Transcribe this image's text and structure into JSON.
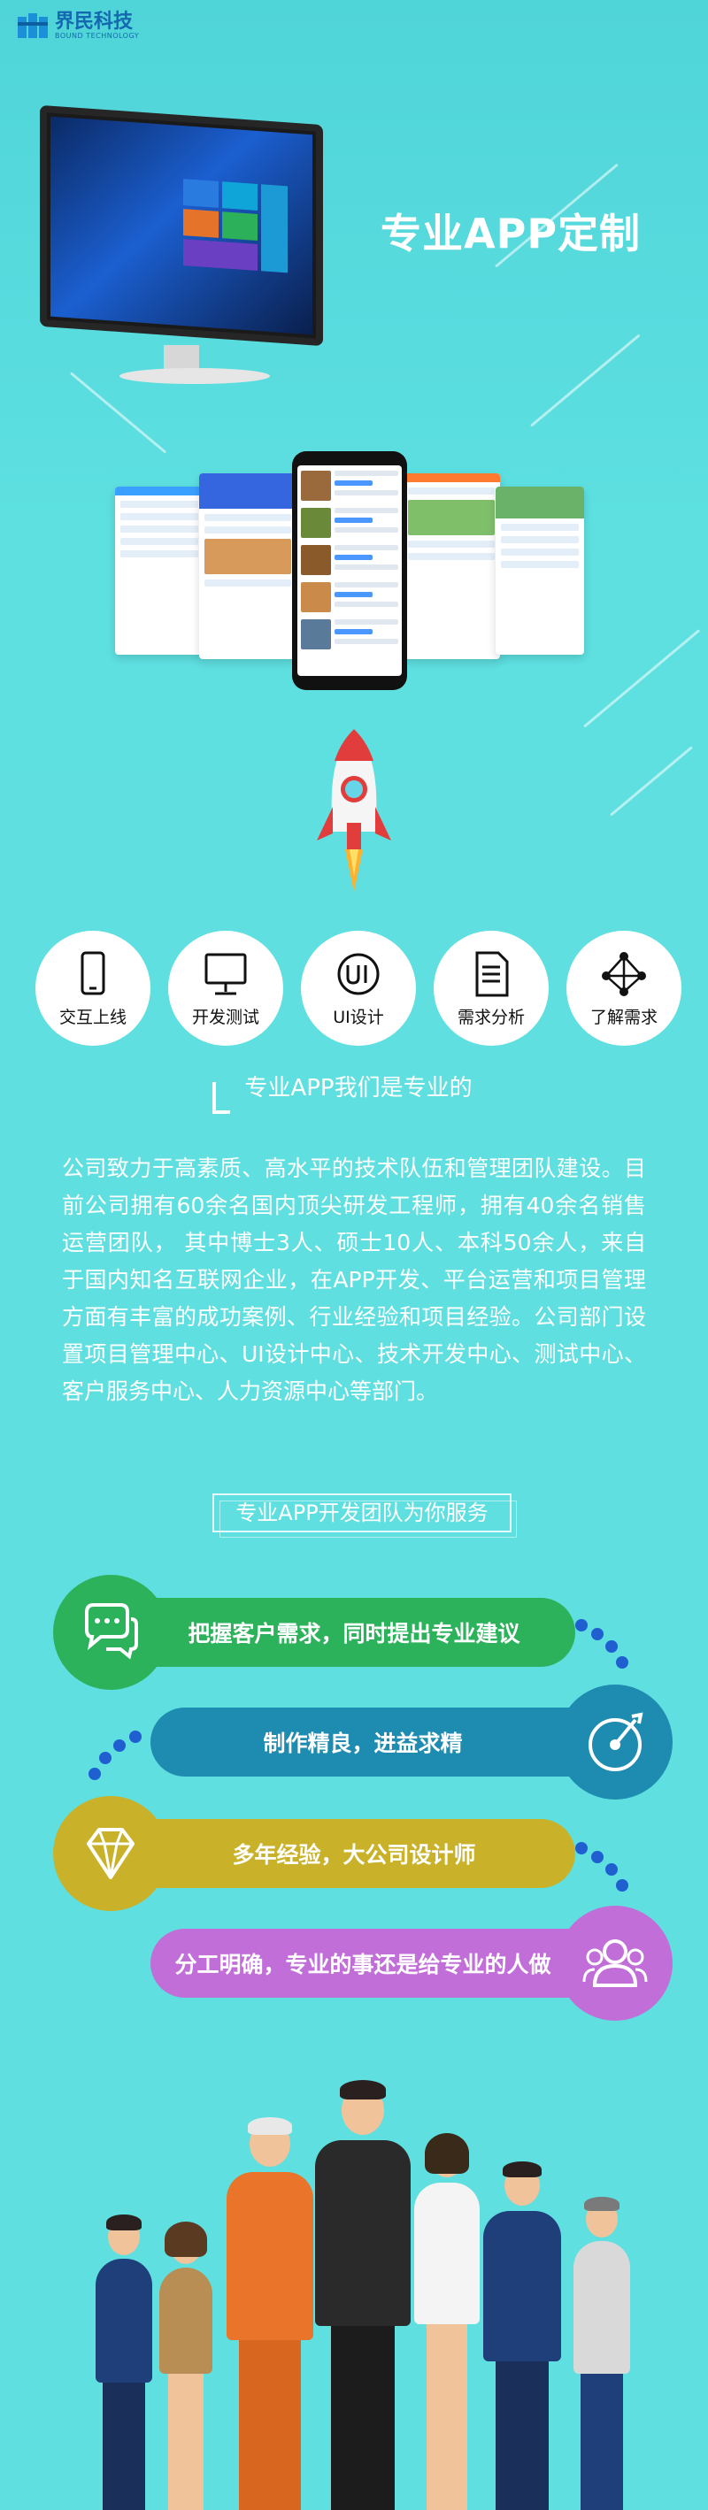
{
  "brand": {
    "name_cn": "界民科技",
    "name_en": "BOUND TECHNOLOGY",
    "color": "#1468b0"
  },
  "hero": {
    "headline": "专业APP定制"
  },
  "steps": [
    {
      "label": "交互上线",
      "icon": "phone-icon"
    },
    {
      "label": "开发测试",
      "icon": "monitor-icon"
    },
    {
      "label": "UI设计",
      "icon": "ui-icon"
    },
    {
      "label": "需求分析",
      "icon": "document-icon"
    },
    {
      "label": "了解需求",
      "icon": "network-icon"
    }
  ],
  "section1": {
    "title": "专业APP我们是专业的"
  },
  "intro": {
    "text": "公司致力于高素质、高水平的技术队伍和管理团队建设。目前公司拥有60余名国内顶尖研发工程师，拥有40余名销售运营团队， 其中博士3人、硕士10人、本科50余人，来自于国内知名互联网企业，在APP开发、平台运营和项目管理方面有丰富的成功案例、行业经验和项目经验。公司部门设置项目管理中心、UI设计中心、技术开发中心、测试中心、客户服务中心、人力资源中心等部门。"
  },
  "section2": {
    "title": "专业APP开发团队为你服务"
  },
  "features": [
    {
      "text": "把握客户需求，同时提出专业建议",
      "color": "#2db25c",
      "icon": "chat-icon"
    },
    {
      "text": "制作精良，进益求精",
      "color": "#1e8bb0",
      "icon": "target-icon"
    },
    {
      "text": "多年经验，大公司设计师",
      "color": "#c9b229",
      "icon": "diamond-icon"
    },
    {
      "text": "分工明确，专业的事还是给专业的人做",
      "color": "#c26ed8",
      "icon": "team-icon"
    }
  ],
  "colors": {
    "background": "#5fdfe0",
    "dots": "#1f5fd0"
  }
}
